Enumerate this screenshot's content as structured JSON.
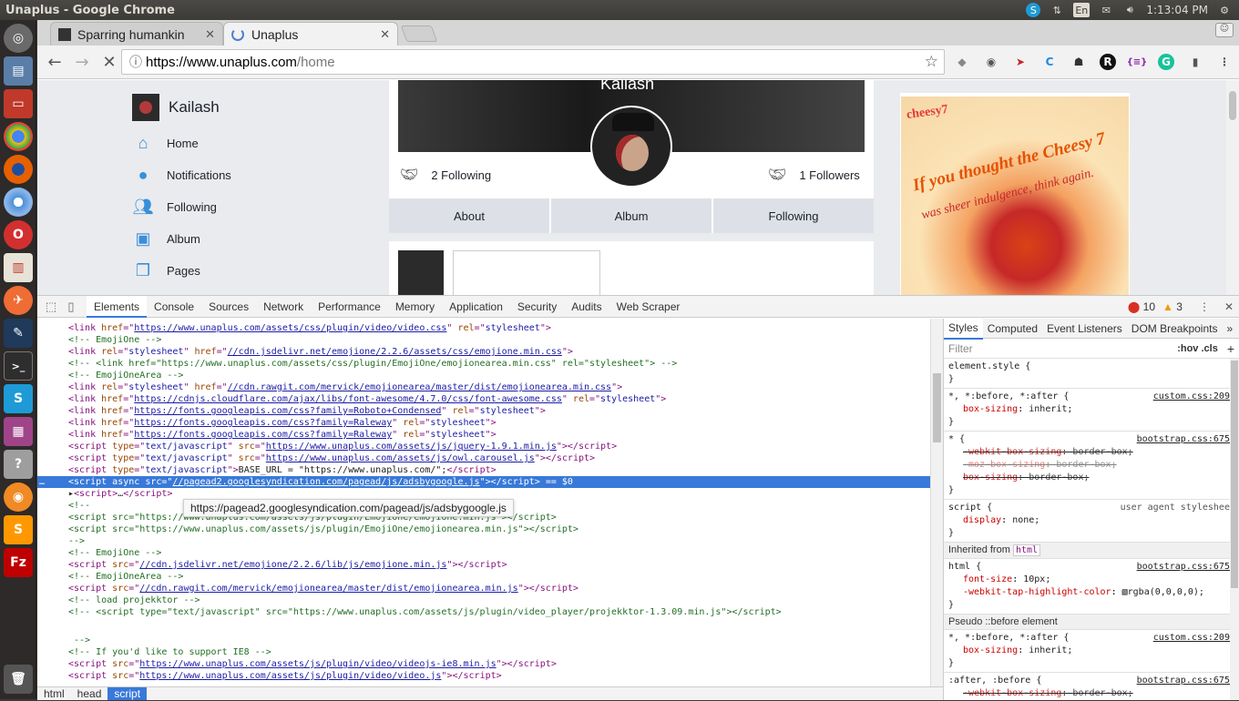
{
  "system": {
    "window_title": "Unaplus - Google Chrome",
    "keyboard": "En",
    "clock": "1:13:04 PM"
  },
  "browser": {
    "tabs": [
      {
        "label": "Sparring humankin"
      },
      {
        "label": "Unaplus"
      }
    ],
    "url_domain": "https://www.unaplus.com",
    "url_path": "/home"
  },
  "page": {
    "user_name": "Kailash",
    "nav": [
      {
        "label": "Home",
        "icon": "home-icon"
      },
      {
        "label": "Notifications",
        "icon": "notifications-icon"
      },
      {
        "label": "Following",
        "icon": "following-icon"
      },
      {
        "label": "Album",
        "icon": "album-icon"
      },
      {
        "label": "Pages",
        "icon": "pages-icon"
      }
    ],
    "cover_name": "Kailash",
    "following_count": "2 Following",
    "followers_count": "1 Followers",
    "profile_tabs": [
      "About",
      "Album",
      "Following"
    ],
    "ad": {
      "brand": "cheesy7",
      "headline": "If you thought the Cheesy 7",
      "tagline": "was sheer indulgence, think again."
    }
  },
  "devtools": {
    "tabs": [
      "Elements",
      "Console",
      "Sources",
      "Network",
      "Performance",
      "Memory",
      "Application",
      "Security",
      "Audits",
      "Web Scraper"
    ],
    "errors": "10",
    "warnings": "3",
    "tooltip": "https://pagead2.googlesyndication.com/pagead/js/adsbygoogle.js",
    "breadcrumbs": [
      "html",
      "head",
      "script"
    ],
    "styles_tabs": [
      "Styles",
      "Computed",
      "Event Listeners",
      "DOM Breakpoints"
    ],
    "filter_placeholder": "Filter",
    "filter_toggles": ":hov .cls",
    "inherited_label": "Inherited from",
    "inherited_tag": "html",
    "pseudo_label": "Pseudo ::before element"
  }
}
